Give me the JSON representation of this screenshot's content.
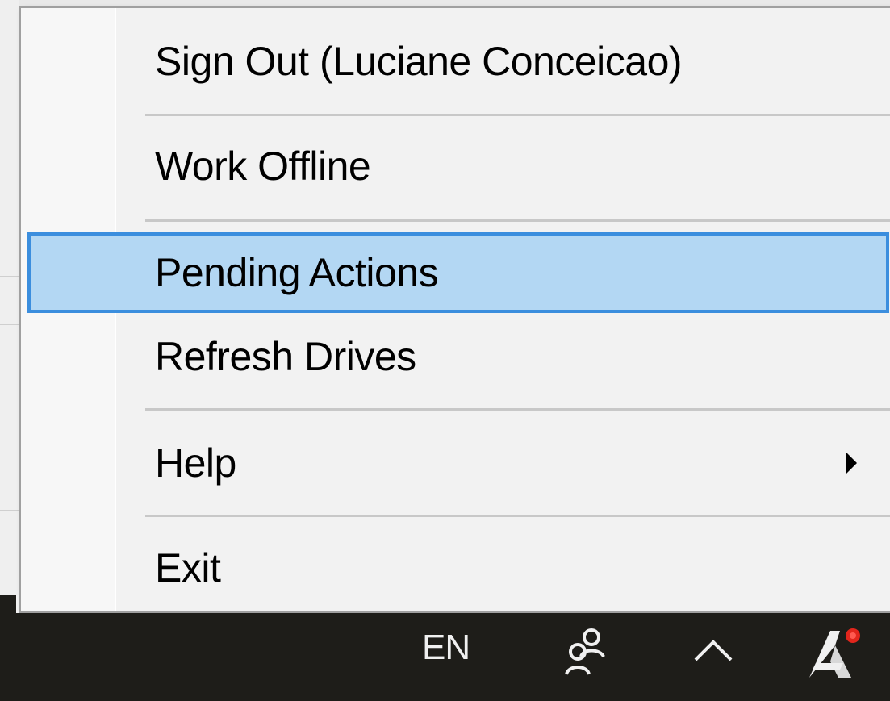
{
  "menu": {
    "items": [
      {
        "label": "Sign Out (Luciane Conceicao)",
        "highlighted": false,
        "submenu": false
      },
      {
        "label": "Work Offline",
        "highlighted": false,
        "submenu": false
      },
      {
        "label": "Pending Actions",
        "highlighted": true,
        "submenu": false
      },
      {
        "label": "Refresh Drives",
        "highlighted": false,
        "submenu": false
      },
      {
        "label": "Help",
        "highlighted": false,
        "submenu": true
      },
      {
        "label": "Exit",
        "highlighted": false,
        "submenu": false
      }
    ],
    "highlight_color": "#b3d7f3",
    "highlight_border_color": "#3b8ede"
  },
  "taskbar": {
    "language": "EN",
    "tray_icons": [
      "people-icon",
      "chevron-up-icon",
      "autodesk-drive-icon"
    ],
    "background_color": "#1e1d19"
  }
}
